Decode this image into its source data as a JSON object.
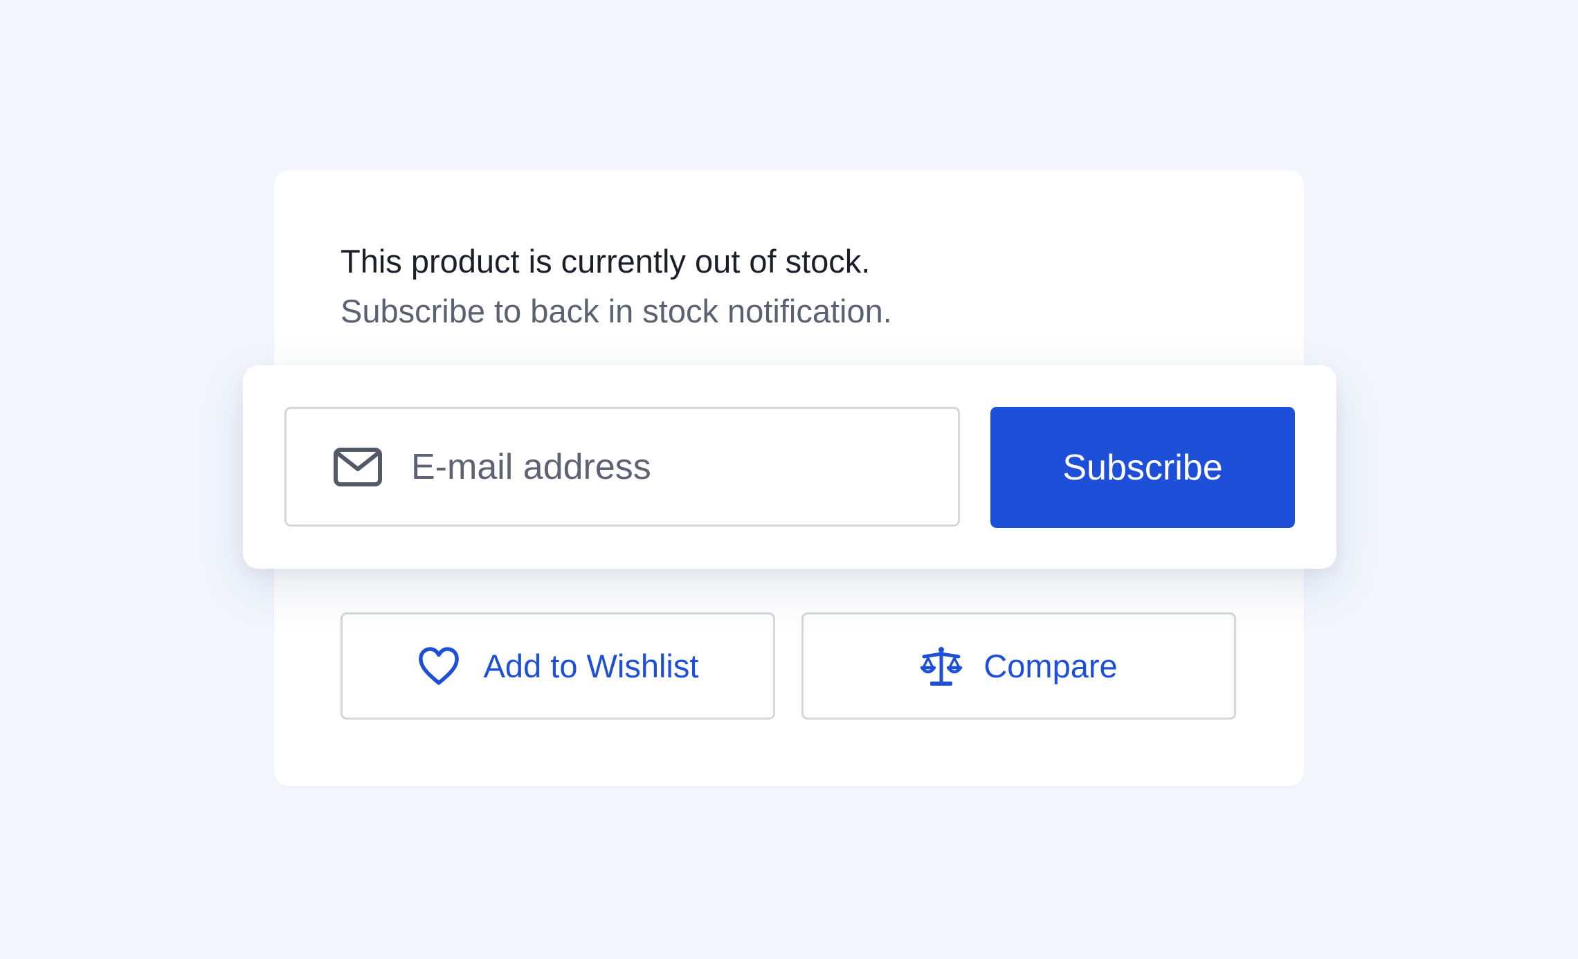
{
  "notice": {
    "out_of_stock": "This product is currently out of stock.",
    "subscribe_prompt": "Subscribe to back in stock notification."
  },
  "subscribe_form": {
    "email_placeholder": "E-mail address",
    "email_value": "",
    "email_icon": "mail-icon",
    "subscribe_label": "Subscribe"
  },
  "actions": {
    "wishlist": {
      "label": "Add to Wishlist",
      "icon": "heart-icon"
    },
    "compare": {
      "label": "Compare",
      "icon": "scale-icon"
    }
  },
  "colors": {
    "page_background": "#f3f6fd",
    "card_background": "#ffffff",
    "accent": "#1d4fd8",
    "primary_text": "#1b1f2a",
    "secondary_text": "#5a6170",
    "border": "#d4d6dc",
    "icon_gray": "#525968"
  }
}
